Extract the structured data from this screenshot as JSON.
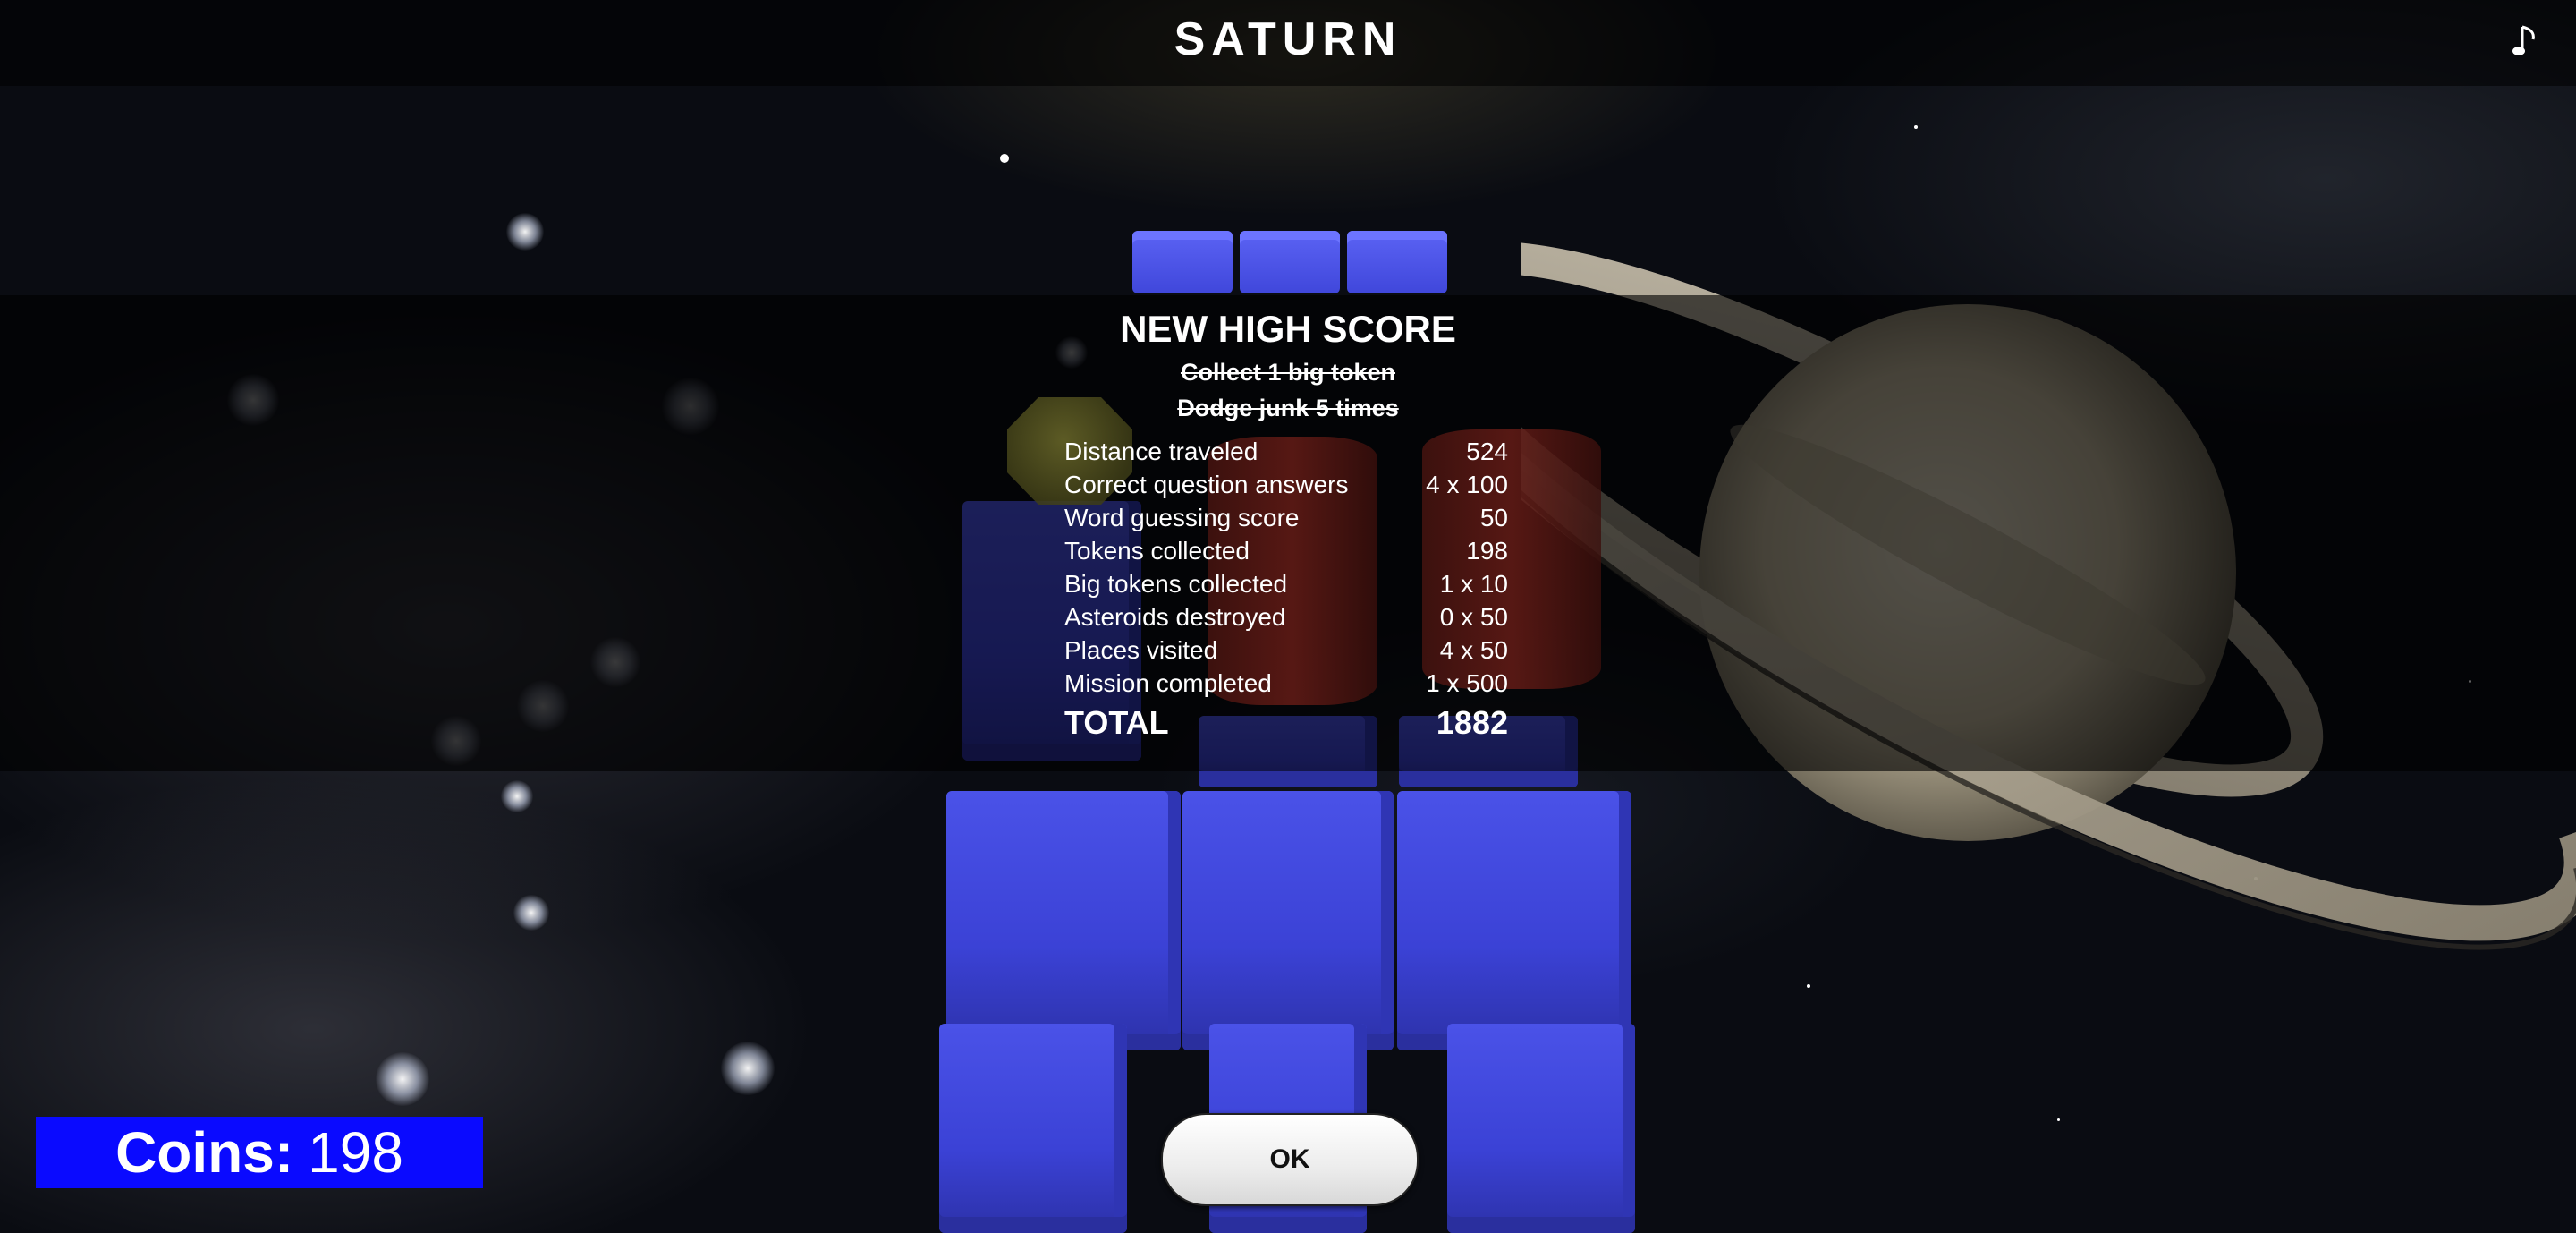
{
  "header": {
    "title": "SATURN",
    "music_icon": "music-note-icon"
  },
  "results": {
    "heading": "NEW HIGH SCORE",
    "missions": [
      "Collect 1 big token",
      "Dodge junk 5 times"
    ],
    "rows": [
      {
        "label": "Distance traveled",
        "value": "524"
      },
      {
        "label": "Correct question answers",
        "value": "4 x 100"
      },
      {
        "label": "Word guessing score",
        "value": "50"
      },
      {
        "label": "Tokens collected",
        "value": "198"
      },
      {
        "label": "Big tokens collected",
        "value": "1 x 10"
      },
      {
        "label": "Asteroids destroyed",
        "value": "0 x 50"
      },
      {
        "label": "Places visited",
        "value": "4 x 50"
      },
      {
        "label": "Mission completed",
        "value": "1 x 500"
      }
    ],
    "total_label": "TOTAL",
    "total_value": "1882"
  },
  "ok_button": {
    "label": "OK"
  },
  "coins": {
    "label": "Coins:",
    "value": "198"
  },
  "colors": {
    "block": "#3b42d6",
    "coins_bg": "#0a0aff",
    "overlay": "rgba(0,0,0,0.62)"
  }
}
